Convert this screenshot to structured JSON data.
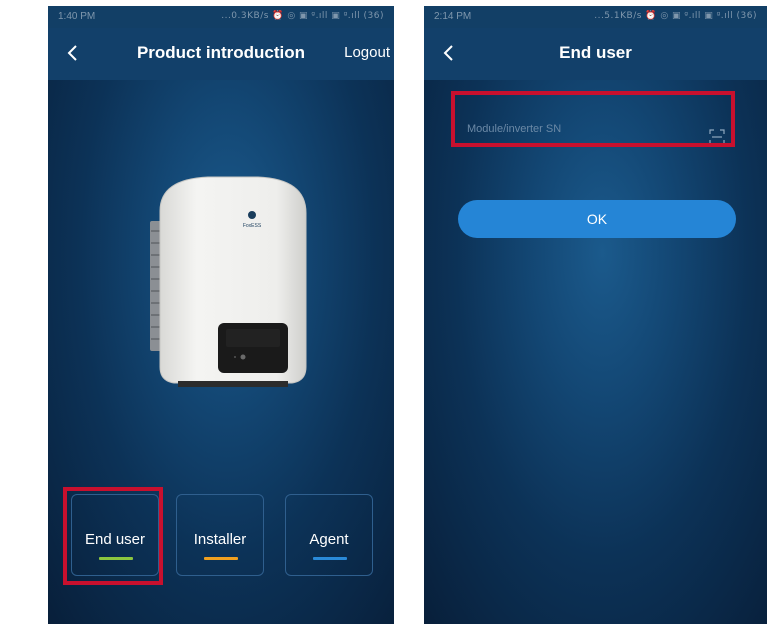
{
  "left_screen": {
    "status": {
      "time": "1:40 PM",
      "indicators": "...0.3KB/s ⏰ ◎ ▣ ᵍ.ıll ▣ ᵍ.ıll (36)"
    },
    "title": "Product introduction",
    "logout_label": "Logout",
    "back_icon": "chevron-left-icon",
    "device_brand": "FoxESS",
    "roles": [
      {
        "label": "End user",
        "accent": "#8cc63f",
        "highlighted": true
      },
      {
        "label": "Installer",
        "accent": "#f0a020",
        "highlighted": false
      },
      {
        "label": "Agent",
        "accent": "#2a8ad8",
        "highlighted": false
      }
    ]
  },
  "right_screen": {
    "status": {
      "time": "2:14 PM",
      "indicators": "...5.1KB/s ⏰ ◎ ▣ ᵍ.ıll ▣ ᵍ.ıll (36)"
    },
    "title": "End user",
    "back_icon": "chevron-left-icon",
    "sn_field": {
      "placeholder": "Module/inverter SN",
      "value": "",
      "icon": "scan-icon",
      "highlighted": true
    },
    "ok_label": "OK"
  },
  "colors": {
    "highlight": "#c8102e",
    "titlebar": "#12406a",
    "button": "#2585d6"
  }
}
